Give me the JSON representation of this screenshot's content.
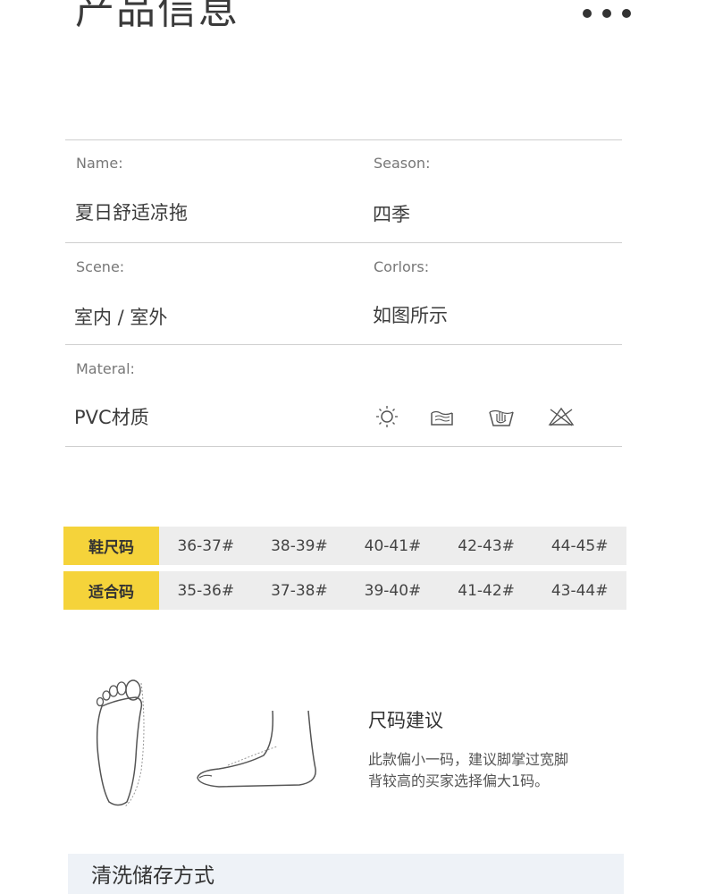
{
  "header": {
    "title": "产品信息"
  },
  "specs": {
    "name_label": "Name:",
    "name_value": "夏日舒适凉拖",
    "season_label": "Season:",
    "season_value": "四季",
    "scene_label": "Scene:",
    "scene_value": "室内 / 室外",
    "colors_label": "Corlors:",
    "colors_value": "如图所示",
    "material_label": "Materal:",
    "material_value": "PVC材质"
  },
  "care_icons": [
    "sun-dry-icon",
    "hand-wash-water-icon",
    "hand-wash-basin-icon",
    "no-bleach-icon"
  ],
  "size_table": {
    "rows": [
      {
        "head": "鞋尺码",
        "cells": [
          "36-37#",
          "38-39#",
          "40-41#",
          "42-43#",
          "44-45#"
        ]
      },
      {
        "head": "适合码",
        "cells": [
          "35-36#",
          "37-38#",
          "39-40#",
          "41-42#",
          "43-44#"
        ]
      }
    ]
  },
  "size_advice": {
    "title": "尺码建议",
    "line1": "此款偏小一码，建议脚掌过宽脚",
    "line2": "背较高的买家选择偏大1码。"
  },
  "care_section": {
    "title": "清洗储存方式"
  },
  "colors": {
    "accent_yellow": "#f5d33a",
    "table_gray": "#ededed",
    "band_blue": "#eef2f7"
  }
}
